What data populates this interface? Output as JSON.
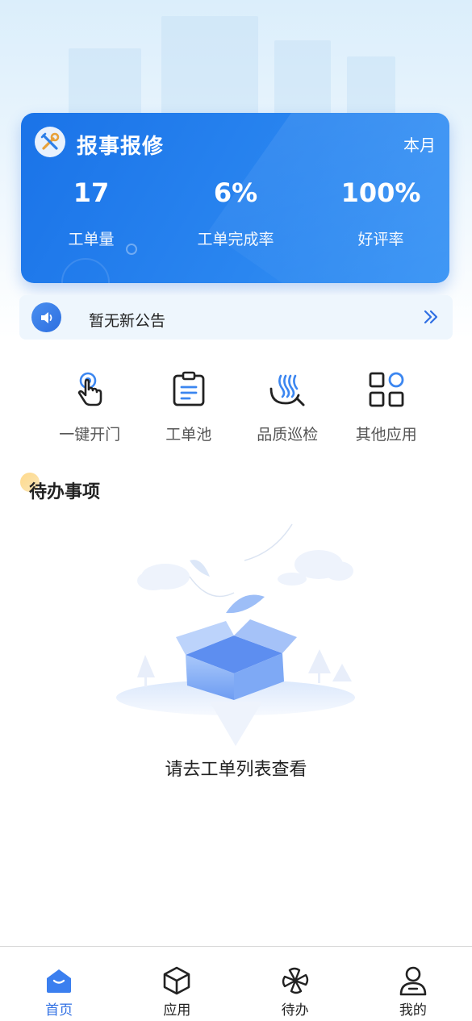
{
  "report": {
    "title": "报事报修",
    "period": "本月",
    "stats": [
      {
        "value": "17",
        "label": "工单量"
      },
      {
        "value": "6%",
        "label": "工单完成率"
      },
      {
        "value": "100%",
        "label": "好评率"
      }
    ]
  },
  "notice": {
    "text": "暂无新公告"
  },
  "apps": [
    {
      "label": "一键开门",
      "icon": "tap-finger-icon"
    },
    {
      "label": "工单池",
      "icon": "clipboard-icon"
    },
    {
      "label": "品质巡检",
      "icon": "inspection-icon"
    },
    {
      "label": "其他应用",
      "icon": "grid-apps-icon"
    }
  ],
  "todo": {
    "title": "待办事项",
    "empty_text": "请去工单列表查看"
  },
  "tabbar": {
    "items": [
      {
        "label": "首页",
        "icon": "home-icon",
        "active": true
      },
      {
        "label": "应用",
        "icon": "cube-icon",
        "active": false
      },
      {
        "label": "待办",
        "icon": "pinwheel-icon",
        "active": false
      },
      {
        "label": "我的",
        "icon": "user-icon",
        "active": false
      }
    ]
  },
  "colors": {
    "primary": "#1a73e8",
    "active_tab": "#2f6fe3",
    "notice_bg": "#eef6fd"
  }
}
